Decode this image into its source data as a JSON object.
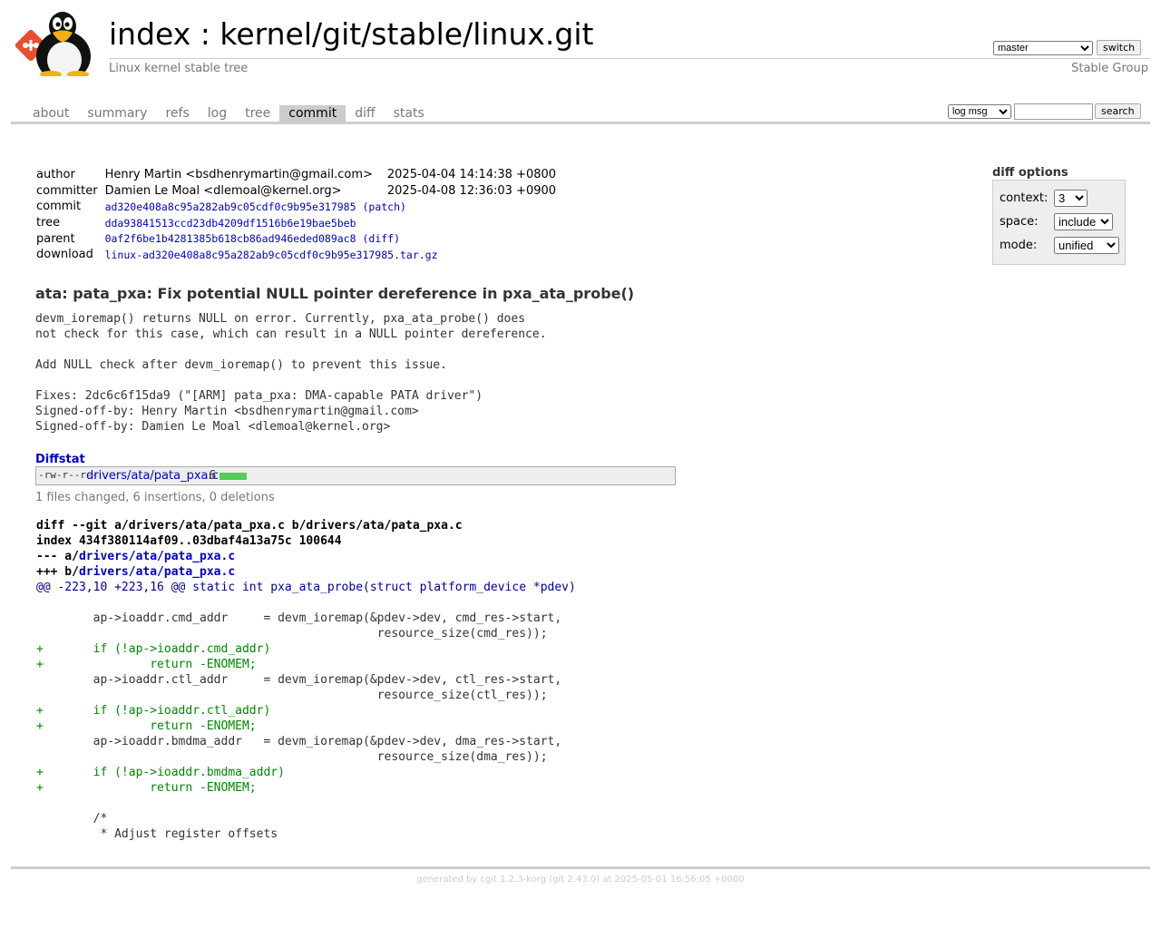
{
  "header": {
    "title_index": "index",
    "title_sep": " : ",
    "title_repo": "kernel/git/stable/linux.git",
    "description": "Linux kernel stable tree",
    "owner": "Stable Group",
    "branch_selected": "master",
    "switch_label": "switch"
  },
  "tabs": [
    {
      "label": "about"
    },
    {
      "label": "summary"
    },
    {
      "label": "refs"
    },
    {
      "label": "log"
    },
    {
      "label": "tree"
    },
    {
      "label": "commit",
      "active": true
    },
    {
      "label": "diff"
    },
    {
      "label": "stats"
    }
  ],
  "search": {
    "mode_selected": "log msg",
    "search_label": "search",
    "query": ""
  },
  "commit_info": {
    "author_label": "author",
    "author": "Henry Martin <bsdhenrymartin@gmail.com>",
    "author_date": "2025-04-04 14:14:38 +0800",
    "committer_label": "committer",
    "committer": "Damien Le Moal <dlemoal@kernel.org>",
    "committer_date": "2025-04-08 12:36:03 +0900",
    "commit_label": "commit",
    "commit_sha": "ad320e408a8c95a282ab9c05cdf0c9b95e317985",
    "patch_link": "patch",
    "tree_label": "tree",
    "tree_sha": "dda93841513ccd23db4209df1516b6e19bae5beb",
    "parent_label": "parent",
    "parent_sha": "0af2f6be1b4281385b618cb86ad946eded089ac8",
    "diff_link": "diff",
    "download_label": "download",
    "download": "linux-ad320e408a8c95a282ab9c05cdf0c9b95e317985.tar.gz"
  },
  "diff_options": {
    "title": "diff options",
    "context_label": "context:",
    "context_value": "3",
    "space_label": "space:",
    "space_value": "include",
    "mode_label": "mode:",
    "mode_value": "unified"
  },
  "subject": "ata: pata_pxa: Fix potential NULL pointer dereference in pxa_ata_probe()",
  "message": "devm_ioremap() returns NULL on error. Currently, pxa_ata_probe() does\nnot check for this case, which can result in a NULL pointer dereference.\n\nAdd NULL check after devm_ioremap() to prevent this issue.\n\nFixes: 2dc6c6f15da9 (\"[ARM] pata_pxa: DMA-capable PATA driver\")\nSigned-off-by: Henry Martin <bsdhenrymartin@gmail.com>\nSigned-off-by: Damien Le Moal <dlemoal@kernel.org>",
  "diffstat": {
    "header": "Diffstat",
    "mode": "-rw-r--r--",
    "file": "drivers/ata/pata_pxa.c",
    "count": "6",
    "insertions_fraction": 1.0,
    "summary": "1 files changed, 6 insertions, 0 deletions"
  },
  "diff": {
    "git_line": "diff --git a/drivers/ata/pata_pxa.c b/drivers/ata/pata_pxa.c",
    "index_line": "index 434f380114af09..03dbaf4a13a75c 100644",
    "minus_prefix": "--- a/",
    "minus_file": "drivers/ata/pata_pxa.c",
    "plus_prefix": "+++ b/",
    "plus_file": "drivers/ata/pata_pxa.c",
    "hunk": "@@ -223,10 +223,16 @@ static int pxa_ata_probe(struct platform_device *pdev)",
    "lines": [
      {
        "type": "ctx",
        "text": " "
      },
      {
        "type": "ctx",
        "text": " \tap->ioaddr.cmd_addr\t= devm_ioremap(&pdev->dev, cmd_res->start,"
      },
      {
        "type": "ctx",
        "text": " \t\t\t\t\t\tresource_size(cmd_res));"
      },
      {
        "type": "add",
        "text": "+\tif (!ap->ioaddr.cmd_addr)"
      },
      {
        "type": "add",
        "text": "+\t\treturn -ENOMEM;"
      },
      {
        "type": "ctx",
        "text": " \tap->ioaddr.ctl_addr\t= devm_ioremap(&pdev->dev, ctl_res->start,"
      },
      {
        "type": "ctx",
        "text": " \t\t\t\t\t\tresource_size(ctl_res));"
      },
      {
        "type": "add",
        "text": "+\tif (!ap->ioaddr.ctl_addr)"
      },
      {
        "type": "add",
        "text": "+\t\treturn -ENOMEM;"
      },
      {
        "type": "ctx",
        "text": " \tap->ioaddr.bmdma_addr\t= devm_ioremap(&pdev->dev, dma_res->start,"
      },
      {
        "type": "ctx",
        "text": " \t\t\t\t\t\tresource_size(dma_res));"
      },
      {
        "type": "add",
        "text": "+\tif (!ap->ioaddr.bmdma_addr)"
      },
      {
        "type": "add",
        "text": "+\t\treturn -ENOMEM;"
      },
      {
        "type": "ctx",
        "text": " "
      },
      {
        "type": "ctx",
        "text": " \t/*"
      },
      {
        "type": "ctx",
        "text": " \t * Adjust register offsets"
      }
    ]
  },
  "footer": "generated by cgit 1.2.3-korg (git 2.43.0) at 2025-05-01 16:56:05 +0000"
}
